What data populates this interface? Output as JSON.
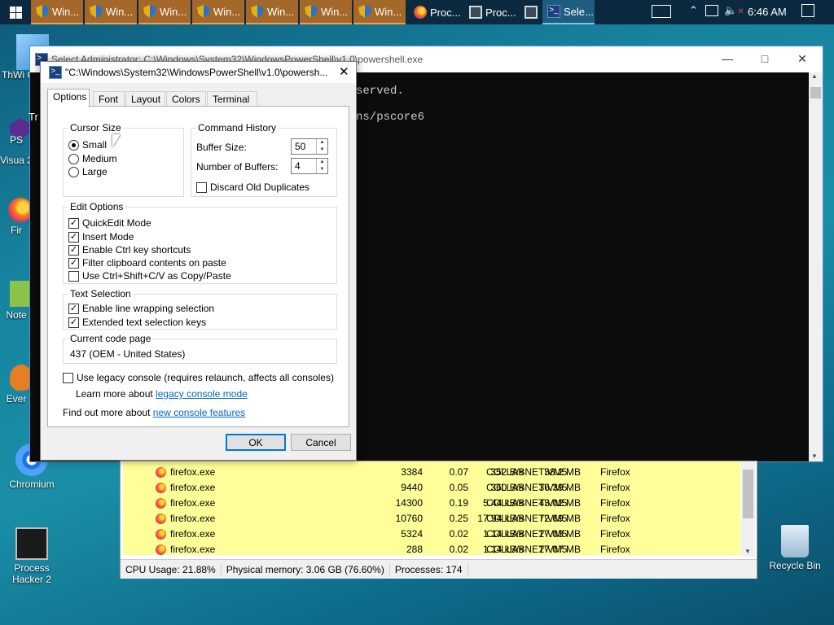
{
  "taskbar": {
    "items": [
      {
        "label": "Win...",
        "icon": "uac-shield-icon"
      },
      {
        "label": "Win...",
        "icon": "uac-shield-icon"
      },
      {
        "label": "Win...",
        "icon": "uac-shield-icon"
      },
      {
        "label": "Win...",
        "icon": "uac-shield-icon"
      },
      {
        "label": "Win...",
        "icon": "uac-shield-icon"
      },
      {
        "label": "Win...",
        "icon": "uac-shield-icon"
      },
      {
        "label": "Win...",
        "icon": "uac-shield-icon"
      },
      {
        "label": "Proc...",
        "icon": "firefox-icon"
      },
      {
        "label": "Proc...",
        "icon": "monitor-icon"
      },
      {
        "label": "",
        "icon": "monitor-icon"
      },
      {
        "label": "Sele...",
        "icon": "powershell-icon"
      }
    ],
    "time": "6:46 AM"
  },
  "desktop": {
    "icons": [
      {
        "label": "ThWi Co"
      },
      {
        "label": "PS"
      },
      {
        "label": "Visua 2"
      },
      {
        "label": "Fir"
      },
      {
        "label": "Note"
      },
      {
        "label": "Ever"
      },
      {
        "label": "Chromium"
      },
      {
        "label": "Process Hacker 2"
      },
      {
        "label": "Recycle Bin"
      }
    ]
  },
  "console": {
    "title": "Select Administrator: C:\\Windows\\System32\\WindowsPowerShell\\v1.0\\powershell.exe",
    "lines": [
      "served.",
      "ns/pscore6"
    ],
    "left_lines": [
      "Tr",
      "PS"
    ]
  },
  "process_hacker": {
    "rows": [
      {
        "name": "firefox.exe",
        "pid": "3384",
        "cpu": "0.07",
        "io": "352 B/s",
        "mem": "38.2 MB",
        "user": "COLLABNET\\VM5",
        "desc": "Firefox"
      },
      {
        "name": "firefox.exe",
        "pid": "9440",
        "cpu": "0.05",
        "io": "360 B/s",
        "mem": "36.39 MB",
        "user": "COLLABNET\\VM5",
        "desc": "Firefox"
      },
      {
        "name": "firefox.exe",
        "pid": "14300",
        "cpu": "0.19",
        "io": "5.44 kB/s",
        "mem": "43.02 MB",
        "user": "COLLABNET\\VM5",
        "desc": "Firefox"
      },
      {
        "name": "firefox.exe",
        "pid": "10760",
        "cpu": "0.25",
        "io": "17.94 kB/s",
        "mem": "72.69 MB",
        "user": "COLLABNET\\VM5",
        "desc": "Firefox"
      },
      {
        "name": "firefox.exe",
        "pid": "5324",
        "cpu": "0.02",
        "io": "1.14 kB/s",
        "mem": "27.03 MB",
        "user": "COLLABNET\\VM5",
        "desc": "Firefox"
      },
      {
        "name": "firefox.exe",
        "pid": "288",
        "cpu": "0.02",
        "io": "1.14 kB/s",
        "mem": "27.07 MB",
        "user": "COLLABNET\\VM5",
        "desc": "Firefox"
      }
    ],
    "status": {
      "cpu": "CPU Usage: 21.88%",
      "memory": "Physical memory: 3.06 GB (76.60%)",
      "processes": "Processes: 174"
    }
  },
  "dialog": {
    "title": "\"C:\\Windows\\System32\\WindowsPowerShell\\v1.0\\powersh...",
    "tabs": [
      "Options",
      "Font",
      "Layout",
      "Colors",
      "Terminal"
    ],
    "cursor_size": {
      "title": "Cursor Size",
      "options": [
        "Small",
        "Medium",
        "Large"
      ],
      "selected": "Small"
    },
    "command_history": {
      "title": "Command History",
      "buffer_size_label": "Buffer Size:",
      "buffer_size": "50",
      "num_buffers_label": "Number of Buffers:",
      "num_buffers": "4",
      "discard_label": "Discard Old Duplicates",
      "discard_checked": false
    },
    "edit_options": {
      "title": "Edit Options",
      "items": [
        {
          "label": "QuickEdit Mode",
          "checked": true
        },
        {
          "label": "Insert Mode",
          "checked": true
        },
        {
          "label": "Enable Ctrl key shortcuts",
          "checked": true
        },
        {
          "label": "Filter clipboard contents on paste",
          "checked": true
        },
        {
          "label": "Use Ctrl+Shift+C/V as Copy/Paste",
          "checked": false
        }
      ]
    },
    "text_selection": {
      "title": "Text Selection",
      "items": [
        {
          "label": "Enable line wrapping selection",
          "checked": true
        },
        {
          "label": "Extended text selection keys",
          "checked": true
        }
      ]
    },
    "code_page": {
      "title": "Current code page",
      "value": "437  (OEM - United States)"
    },
    "legacy": {
      "label": "Use legacy console (requires relaunch, affects all consoles)",
      "checked": false,
      "learn_prefix": "Learn more about ",
      "learn_link": "legacy console mode"
    },
    "features": {
      "prefix": "Find out more about ",
      "link": "new console features"
    },
    "ok_label": "OK",
    "cancel_label": "Cancel"
  }
}
